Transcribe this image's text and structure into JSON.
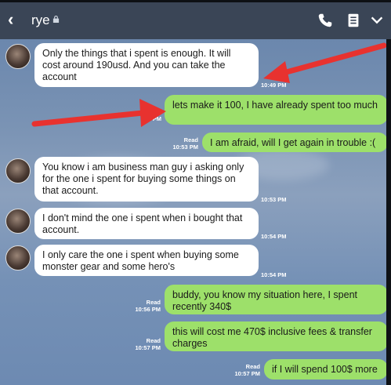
{
  "header": {
    "back_icon": "chevron-left-icon",
    "contact_name": "rye",
    "lock_icon": "lock-icon",
    "actions": [
      "phone-icon",
      "notes-icon",
      "chevron-down-icon"
    ]
  },
  "colors": {
    "header_bg": "#3a4556",
    "incoming_bubble": "#ffffff",
    "outgoing_bubble": "#9de06a",
    "annotation_arrow": "#e8322f"
  },
  "messages": [
    {
      "dir": "in",
      "text": "Only the things that i spent is enough. It will cost around 190usd. And you can take the account",
      "time": "10:49 PM"
    },
    {
      "dir": "out",
      "text": "lets make it 100, I have already spent too much",
      "read": "Read",
      "time": "PM"
    },
    {
      "dir": "out",
      "text": "I am afraid, will I get again in trouble :(",
      "read": "Read",
      "time": "10:53 PM"
    },
    {
      "dir": "in",
      "text": "You know i am business man guy i asking only for the one i spent for buying some things on that account.",
      "time": "10:53 PM"
    },
    {
      "dir": "in",
      "text": "I don't mind the one i spent when i bought that account.",
      "time": "10:54 PM"
    },
    {
      "dir": "in",
      "text": "I only care the one i spent when buying some monster gear and some hero's",
      "time": "10:54 PM"
    },
    {
      "dir": "out",
      "text": "buddy, you know my situation here, I spent recently 340$",
      "read": "Read",
      "time": "10:56 PM"
    },
    {
      "dir": "out",
      "text": "this will cost me 470$ inclusive fees & transfer charges",
      "read": "Read",
      "time": "10:57 PM"
    },
    {
      "dir": "out",
      "text": "if I will spend 100$ more",
      "read": "Read",
      "time": "10:57 PM"
    }
  ]
}
